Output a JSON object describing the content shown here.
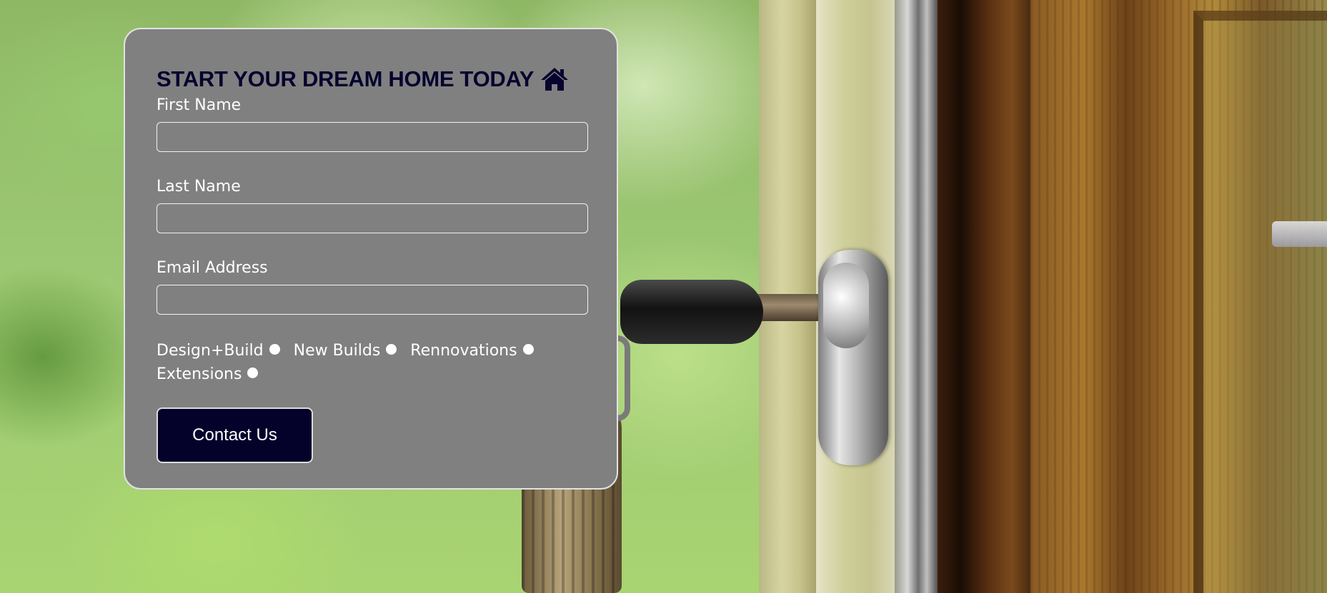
{
  "form": {
    "title": "START YOUR DREAM HOME TODAY",
    "title_icon": "home-icon",
    "fields": [
      {
        "label": "First Name",
        "value": "",
        "placeholder": ""
      },
      {
        "label": "Last Name",
        "value": "",
        "placeholder": ""
      },
      {
        "label": "Email Address",
        "value": "",
        "placeholder": ""
      }
    ],
    "options": [
      {
        "label": "Design+Build",
        "selected": false
      },
      {
        "label": "New Builds",
        "selected": false
      },
      {
        "label": "Rennovations",
        "selected": false
      },
      {
        "label": "Extensions",
        "selected": false
      }
    ],
    "submit_label": "Contact Us"
  },
  "colors": {
    "card_background": "#808080",
    "title": "#06032e",
    "button_background": "#04012b",
    "text": "#ffffff"
  }
}
